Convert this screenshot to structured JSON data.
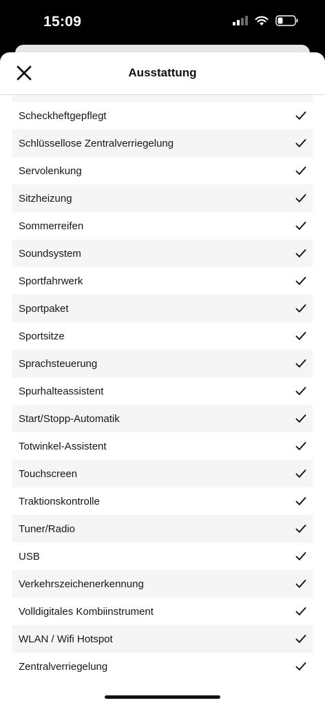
{
  "status_bar": {
    "time": "15:09"
  },
  "header": {
    "title": "Ausstattung",
    "close_icon": "close-icon"
  },
  "features": [
    {
      "label": "Scheckheftgepflegt"
    },
    {
      "label": "Schlüssellose Zentralverriegelung"
    },
    {
      "label": "Servolenkung"
    },
    {
      "label": "Sitzheizung"
    },
    {
      "label": "Sommerreifen"
    },
    {
      "label": "Soundsystem"
    },
    {
      "label": "Sportfahrwerk"
    },
    {
      "label": "Sportpaket"
    },
    {
      "label": "Sportsitze"
    },
    {
      "label": "Sprachsteuerung"
    },
    {
      "label": "Spurhalteassistent"
    },
    {
      "label": "Start/Stopp-Automatik"
    },
    {
      "label": "Totwinkel-Assistent"
    },
    {
      "label": "Touchscreen"
    },
    {
      "label": "Traktionskontrolle"
    },
    {
      "label": "Tuner/Radio"
    },
    {
      "label": "USB"
    },
    {
      "label": "Verkehrszeichenerkennung"
    },
    {
      "label": "Volldigitales Kombiinstrument"
    },
    {
      "label": "WLAN / Wifi Hotspot"
    },
    {
      "label": "Zentralverriegelung"
    }
  ],
  "colors": {
    "row_shade": "#f5f5f5",
    "text": "#161616"
  }
}
